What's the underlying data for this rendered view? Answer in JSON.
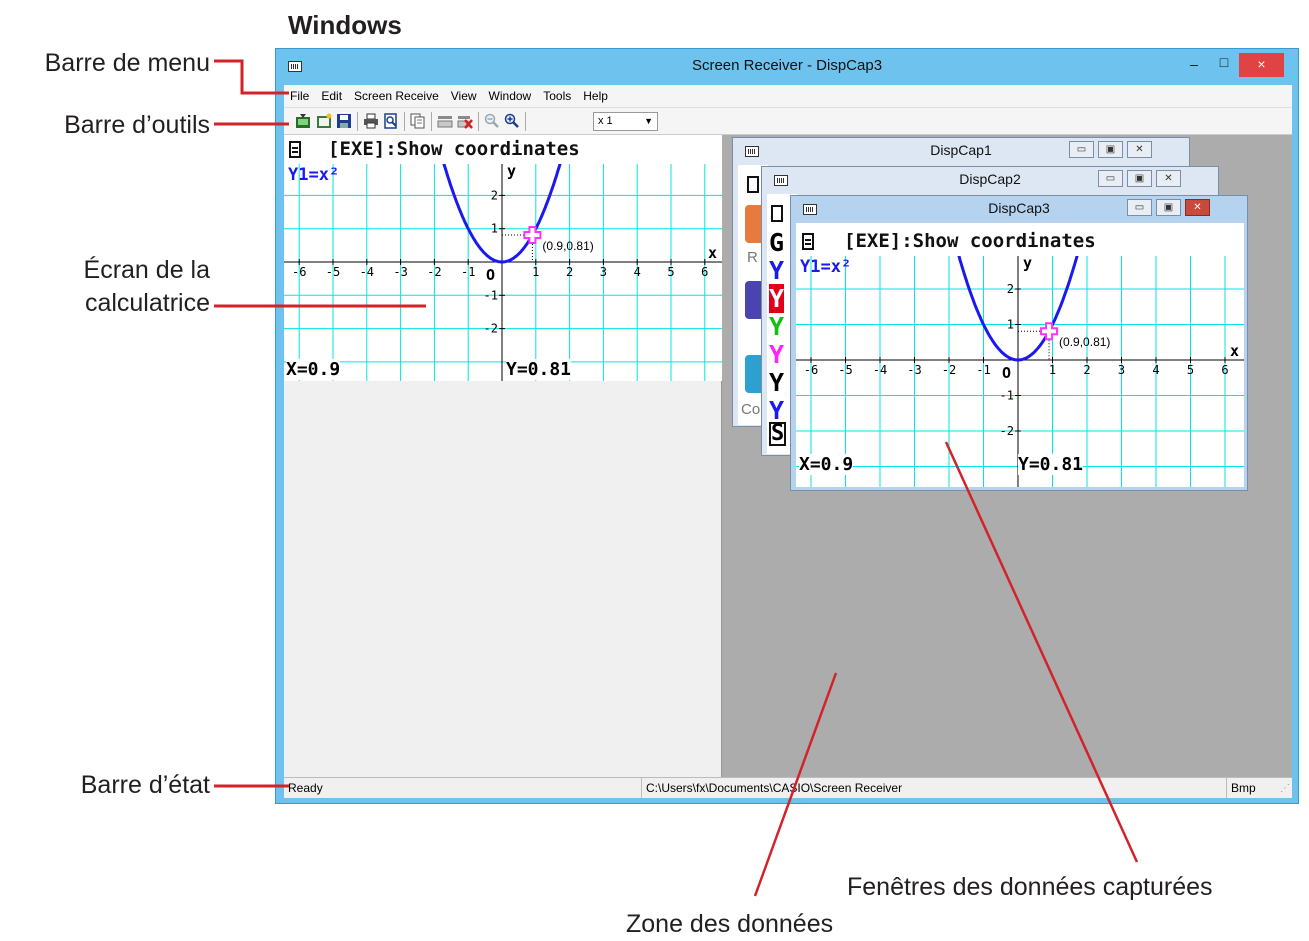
{
  "heading": "Windows",
  "callouts": {
    "menu_bar": "Barre de menu",
    "toolbar": "Barre d’outils",
    "calc_screen_line1": "Écran de la",
    "calc_screen_line2": "calculatrice",
    "status_bar": "Barre d’état",
    "capture_windows": "Fenêtres des données capturées",
    "data_area": "Zone des données"
  },
  "window": {
    "title": "Screen Receiver - DispCap3",
    "minimize": "–",
    "maximize": "□",
    "close": "×"
  },
  "menu": [
    "File",
    "Edit",
    "Screen Receive",
    "View",
    "Window",
    "Tools",
    "Help"
  ],
  "toolbar": {
    "icons": [
      "receive-icon",
      "new-icon",
      "save-icon",
      "print-icon",
      "print-preview-icon",
      "copy-icon",
      "clear-icon",
      "delete-icon",
      "zoom-out-icon",
      "zoom-in-icon"
    ],
    "zoom_value": "x 1"
  },
  "calculator": {
    "header": "[EXE]:Show coordinates",
    "function": "Y1=x²",
    "x_readout": "X=0.9",
    "y_readout": "Y=0.81",
    "point_label": "(0.9,0.81)",
    "axis_x": "x",
    "axis_y": "y",
    "origin": "O",
    "x_ticks": [
      "-6",
      "-5",
      "-4",
      "-3",
      "-2",
      "-1",
      "1",
      "2",
      "3",
      "4",
      "5",
      "6"
    ],
    "y_ticks": [
      "2",
      "1",
      "-1",
      "-2"
    ],
    "point": {
      "x": 0.9,
      "y": 0.81
    }
  },
  "sub_windows": {
    "cap1": {
      "title": "DispCap1"
    },
    "cap2": {
      "title": "DispCap2"
    },
    "cap3": {
      "title": "DispCap3"
    },
    "btn_min": "▭",
    "btn_max": "▣",
    "btn_close": "✕",
    "partial_text": {
      "r": "R",
      "co": "Co",
      "g": "G",
      "y": "Y",
      "s": "S"
    }
  },
  "status": {
    "state": "Ready",
    "path": "C:\\Users\\fx\\Documents\\CASIO\\Screen Receiver",
    "format": "Bmp"
  },
  "colors": {
    "titlebar": "#6ec3ee",
    "mdi_background": "#acacac",
    "grid": "#00e5e5",
    "curve": "#1a1aee",
    "cursor": "#ff33ff",
    "annotation_red": "#d2232a"
  }
}
